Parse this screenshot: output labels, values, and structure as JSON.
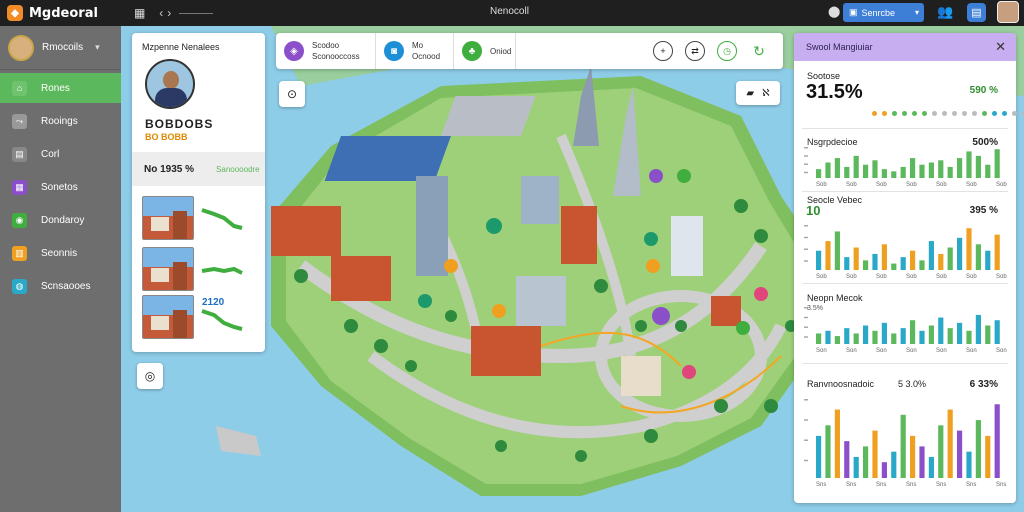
{
  "topbar": {
    "app_title": "Mgdeoral",
    "center_title": "Nenocoll",
    "search_label": "Senrcbe",
    "icons": [
      "app-logo-icon",
      "grid-icon",
      "back-icon",
      "forward-icon",
      "pin-icon",
      "search-icon",
      "people-icon",
      "document-icon"
    ]
  },
  "sidebar": {
    "user_name": "Rmocoils",
    "items": [
      {
        "label": "Rones",
        "icon": "home-icon",
        "color": "#6fc36f",
        "active": true
      },
      {
        "label": "Rooings",
        "icon": "route-icon",
        "color": "#999999",
        "active": false
      },
      {
        "label": "Corl",
        "icon": "clipboard-icon",
        "color": "#888888",
        "active": false
      },
      {
        "label": "Sonetos",
        "icon": "grid-icon",
        "color": "#8a4fc9",
        "active": false
      },
      {
        "label": "Dondaroy",
        "icon": "circle-icon",
        "color": "#3fae3f",
        "active": false
      },
      {
        "label": "Seonnis",
        "icon": "chart-icon",
        "color": "#f0a020",
        "active": false
      },
      {
        "label": "Scnsaooes",
        "icon": "globe-icon",
        "color": "#2aa8c8",
        "active": false
      }
    ]
  },
  "profile_panel": {
    "title": "Mzpenne Nenalees",
    "code": "BOBDOBS",
    "subtitle": "BO BOBB",
    "stat_value": "No 1935 %",
    "stat_tag": "Sanoooodre",
    "tours": [
      {
        "label": "",
        "route": "up"
      },
      {
        "label": "",
        "route": "flat"
      },
      {
        "label": "2120",
        "route": "down"
      }
    ]
  },
  "toolbar": {
    "segments": [
      {
        "icon": "layers-icon",
        "color": "#8a4fc9",
        "line1": "Scodoo",
        "line2": "Sconooccoss"
      },
      {
        "icon": "camera-icon",
        "color": "#1d8fd6",
        "line1": "Mo",
        "line2": "Ocnood"
      },
      {
        "icon": "plant-icon",
        "color": "#3fae3f",
        "line1": "Oniod",
        "line2": ""
      }
    ],
    "buttons": [
      "add-location-icon",
      "swap-icon",
      "time-icon",
      "refresh-icon"
    ]
  },
  "map_controls": {
    "compass": "compass-icon",
    "locate": "locate-icon",
    "weather_label": "ℵ",
    "car_icon": "car-icon"
  },
  "analytics": {
    "title": "Swool Mangiuiar",
    "stat1": {
      "label": "Sootose",
      "value": "31.5%",
      "right": "590 %"
    },
    "dots": [
      "#f0a020",
      "#f0a020",
      "#5cb85c",
      "#5cb85c",
      "#5cb85c",
      "#5cb85c",
      "#bcbcbc",
      "#bcbcbc",
      "#bcbcbc",
      "#bcbcbc",
      "#bcbcbc",
      "#5cb85c",
      "#2aa8c8",
      "#2aa8c8",
      "#bcbcbc",
      "#bcbcbc"
    ],
    "stat2": {
      "label": "Nsgrpdecioe",
      "right": "500%"
    },
    "stat3": {
      "label": "Seocle Vebec",
      "value": "10",
      "right": "395 %"
    },
    "stat4": {
      "label": "Neopn Mecok",
      "sub": "3.5%"
    },
    "stat5": {
      "label": "Ranvnoosnadoic",
      "mid": "5 3.0%",
      "right": "6 33%"
    }
  },
  "chart_data": [
    {
      "type": "bar",
      "title": "Nsgrpdecioe",
      "categories": [
        "Sob",
        "Sob",
        "Sob",
        "Sob",
        "Sob",
        "Sob",
        "Sob"
      ],
      "values": [
        4,
        7,
        9,
        5,
        10,
        6,
        8,
        4,
        3,
        5,
        9,
        6,
        7,
        8,
        5,
        9,
        12,
        10,
        6,
        13
      ],
      "colors": [
        "#5cb85c"
      ],
      "ylim": [
        0,
        14
      ]
    },
    {
      "type": "bar",
      "title": "Seocle Vebec",
      "categories": [
        "Sob",
        "Sob",
        "Sob",
        "Sob",
        "Sob",
        "Sob",
        "Sob"
      ],
      "values": [
        6,
        9,
        12,
        4,
        7,
        3,
        5,
        8,
        2,
        4,
        6,
        3,
        9,
        5,
        7,
        10,
        13,
        8,
        6,
        11
      ],
      "colors": [
        "#2aa8c8",
        "#f0a020",
        "#5cb85c"
      ],
      "ylim": [
        0,
        14
      ]
    },
    {
      "type": "bar",
      "title": "Neopn Mecok",
      "categories": [
        "Son",
        "Son",
        "Son",
        "Son",
        "Son",
        "Son",
        "Son"
      ],
      "values": [
        4,
        5,
        3,
        6,
        4,
        7,
        5,
        8,
        4,
        6,
        9,
        5,
        7,
        10,
        6,
        8,
        5,
        11,
        7,
        9
      ],
      "colors": [
        "#5cb85c",
        "#2aa8c8"
      ],
      "ylim": [
        0,
        14
      ]
    },
    {
      "type": "bar",
      "title": "Ranvnoosnadoic",
      "categories": [
        "Sns",
        "Sns",
        "Sns",
        "Sns",
        "Sns",
        "Sns",
        "Sns"
      ],
      "values": [
        8,
        10,
        13,
        7,
        4,
        6,
        9,
        3,
        5,
        12,
        8,
        6,
        4,
        10,
        13,
        9,
        5,
        11,
        8,
        14
      ],
      "colors": [
        "#2aa8c8",
        "#5cb85c",
        "#f0a020",
        "#8a4fc9"
      ],
      "ylim": [
        0,
        15
      ]
    }
  ]
}
